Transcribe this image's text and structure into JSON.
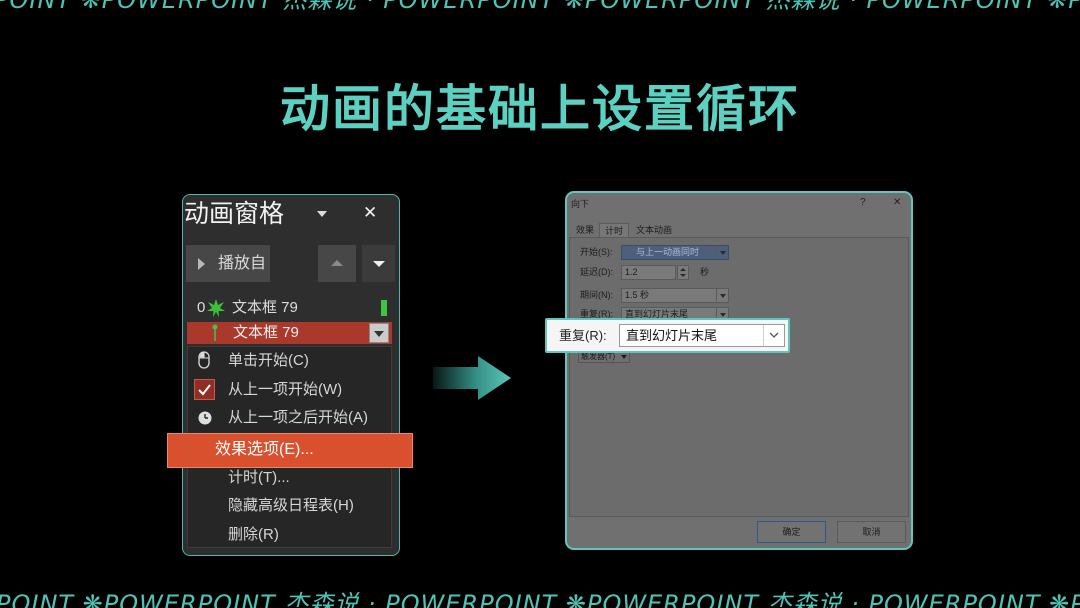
{
  "banner": {
    "top_text": "POINT ❋POWERPOINT 杰森说 · POWERPOINT ❋POWERPOINT 杰森说 · POWERPOINT ❋POWERPOINT",
    "bottom_text": "POINT ❋POWERPOINT 杰森说 · POWERPOINT ❋POWERPOINT 杰森说 · POWERPOINT ❋POWERPOINT"
  },
  "title": "动画的基础上设置循环",
  "pane": {
    "title": "动画窗格",
    "close": "✕",
    "play_label": "播放自",
    "rows": [
      {
        "index": "0",
        "label": "文本框 79",
        "icon": "star-effect-icon"
      },
      {
        "label": "文本框 79",
        "icon": "motion-path-icon",
        "selected": true
      }
    ],
    "menu": [
      {
        "label": "单击开始(C)",
        "icon": "mouse-icon"
      },
      {
        "label": "从上一项开始(W)",
        "icon": "checkmark-icon",
        "checked": true
      },
      {
        "label": "从上一项之后开始(A)",
        "icon": "clock-icon"
      },
      {
        "label": "效果选项(E)...",
        "highlighted": true
      },
      {
        "label": "计时(T)..."
      },
      {
        "label": "隐藏高级日程表(H)"
      },
      {
        "label": "删除(R)"
      }
    ]
  },
  "dialog": {
    "title": "向下",
    "help": "?",
    "close": "✕",
    "tabs": [
      "效果",
      "计时",
      "文本动画"
    ],
    "active_tab": "计时",
    "start": {
      "label": "开始(S):",
      "value": "与上一动画同时"
    },
    "delay": {
      "label": "延迟(D):",
      "value": "1.2",
      "unit": "秒"
    },
    "duration": {
      "label": "期间(N):",
      "value": "1.5 秒"
    },
    "repeat": {
      "label": "重复(R):",
      "value": "直到幻灯片末尾"
    },
    "triggers": "触发器(T)",
    "ok": "确定",
    "cancel": "取消"
  },
  "callout": {
    "label": "重复(R):",
    "value": "直到幻灯片末尾"
  },
  "colors": {
    "accent": "#5ccfc0",
    "highlight": "#d9502f",
    "selected_row": "#a8392b",
    "timing_bar": "#3fc43f",
    "background": "#000000"
  }
}
